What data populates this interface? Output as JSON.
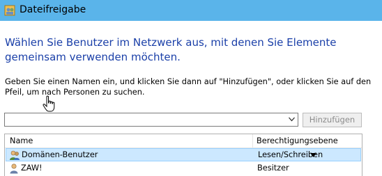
{
  "window": {
    "title": "Dateifreigabe",
    "title_bar_color": "#5ab4ea"
  },
  "main": {
    "heading": "Wählen Sie Benutzer im Netzwerk aus, mit denen Sie Elemente gemeinsam verwenden möchten.",
    "instruction": "Geben Sie einen Namen ein, und klicken Sie dann auf \"Hinzufügen\", oder klicken Sie auf den Pfeil, um nach Personen zu suchen.",
    "heading_color": "#1a3fa8"
  },
  "name_input": {
    "value": "",
    "icon": "dropdown-arrow-icon"
  },
  "add_button": {
    "label": "Hinzufügen",
    "enabled": false
  },
  "sharing_list": {
    "columns": [
      "Name",
      "Berechtigungsebene"
    ],
    "rows": [
      {
        "name": "Domänen-Benutzer",
        "permission": "Lesen/Schreiben",
        "icon": "user-group-icon",
        "selected": true
      },
      {
        "name": "ZAW!",
        "permission": "Besitzer",
        "icon": "user-icon",
        "selected": false
      }
    ],
    "selection_color": "#cce8ff"
  },
  "cursor": {
    "icon": "hand-pointer-icon"
  }
}
